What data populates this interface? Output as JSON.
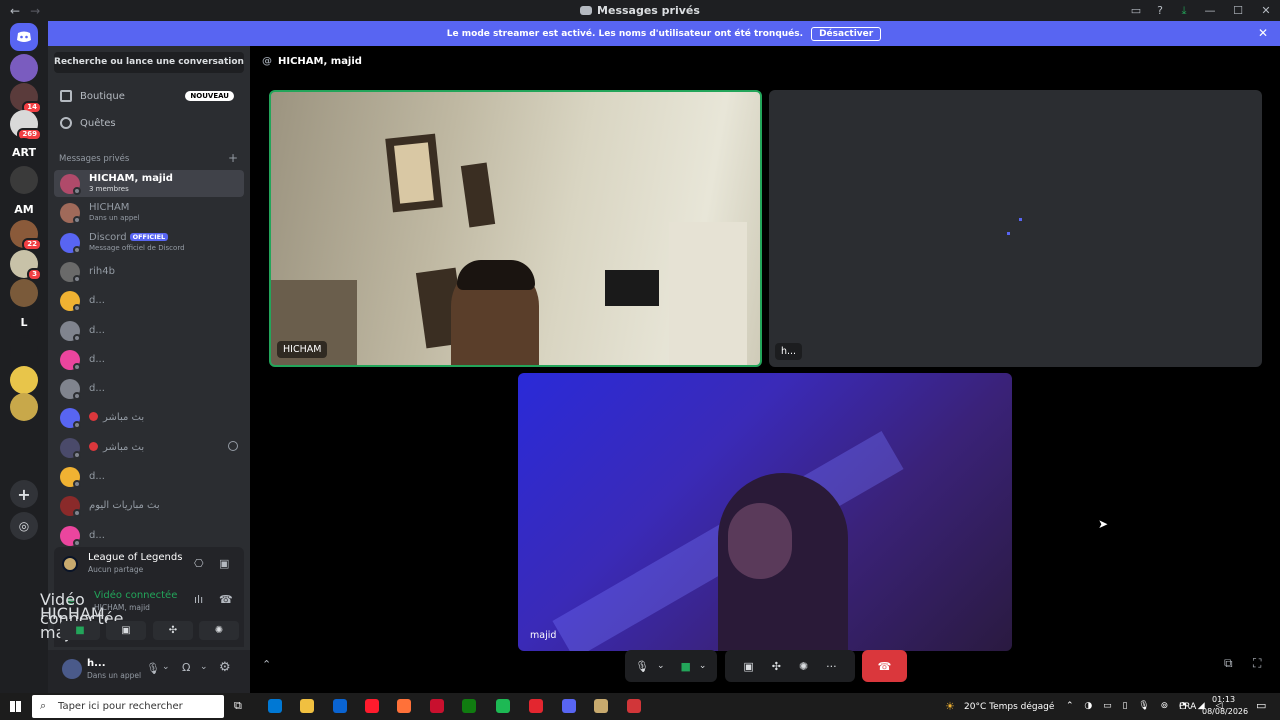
{
  "window": {
    "title": "Messages privés"
  },
  "guilds": [
    {
      "label": "",
      "badge": "",
      "color": "#5865f2"
    },
    {
      "label": "",
      "badge": "",
      "color": "#7a5cbf"
    },
    {
      "label": "",
      "badge": "14",
      "color": "#5a3b3b"
    },
    {
      "label": "",
      "badge": "269",
      "color": "#d9d9d9"
    },
    {
      "label": "ART",
      "badge": "",
      "color": "#1e1f22"
    },
    {
      "label": "",
      "badge": "",
      "color": "#3a3a3a"
    },
    {
      "label": "AM",
      "badge": "",
      "color": "#1e1f22"
    },
    {
      "label": "",
      "badge": "22",
      "color": "#8a5a3a"
    },
    {
      "label": "",
      "badge": "3",
      "color": "#c8c2a8"
    },
    {
      "label": "",
      "badge": "",
      "color": "#7a5a3a"
    },
    {
      "label": "L",
      "badge": "",
      "color": "#1e1f22"
    },
    {
      "label": "",
      "badge": "",
      "color": "#1e1f22"
    },
    {
      "label": "",
      "badge": "",
      "color": "#e8c54a"
    },
    {
      "label": "",
      "badge": "",
      "color": "#c8a84a"
    }
  ],
  "banner": {
    "text": "Le mode streamer est activé. Les noms d'utilisateur ont été tronqués.",
    "button": "Désactiver"
  },
  "sidebar": {
    "search_placeholder": "Recherche ou lance une conversation",
    "boutique": "Boutique",
    "nouveau": "NOUVEAU",
    "quetes": "Quêtes",
    "section_title": "Messages privés",
    "dms": [
      {
        "name": "HICHAM, majid",
        "sub": "3 membres",
        "color": "#b04a6a",
        "selected": true
      },
      {
        "name": "HICHAM",
        "sub": "Dans un appel",
        "color": "#a06a5a",
        "selected": false
      },
      {
        "name": "Discord",
        "sub": "Message officiel de Discord",
        "color": "#5865f2",
        "selected": false,
        "official": "OFFICIEL"
      },
      {
        "name": "rih4b",
        "sub": "",
        "color": "#6a6a6a",
        "selected": false
      },
      {
        "name": "d...",
        "sub": "",
        "color": "#f0b232",
        "selected": false
      },
      {
        "name": "d...",
        "sub": "",
        "color": "#80848e",
        "selected": false
      },
      {
        "name": "d...",
        "sub": "",
        "color": "#eb459e",
        "selected": false
      },
      {
        "name": "d...",
        "sub": "",
        "color": "#80848e",
        "selected": false
      },
      {
        "name": "بث مباشر",
        "sub": "",
        "color": "#5865f2",
        "selected": false,
        "live": true
      },
      {
        "name": "بث مباشر",
        "sub": "",
        "color": "#4a4a6a",
        "selected": false,
        "live": true,
        "closable": true
      },
      {
        "name": "d...",
        "sub": "",
        "color": "#f0b232",
        "selected": false
      },
      {
        "name": "بث مباريات اليوم",
        "sub": "",
        "color": "#8a2a2a",
        "selected": false
      },
      {
        "name": "d...",
        "sub": "",
        "color": "#eb459e",
        "selected": false
      }
    ]
  },
  "activity": {
    "game": "League of Legends",
    "status": "Aucun partage"
  },
  "voice": {
    "status": "Vidéo connectée",
    "channel": "HICHAM, majid"
  },
  "user": {
    "name": "h...",
    "status": "Dans un appel"
  },
  "main": {
    "header": "HICHAM, majid",
    "tiles": [
      {
        "label": "HICHAM"
      },
      {
        "label": "h..."
      },
      {
        "label": "majid"
      }
    ]
  },
  "taskbar": {
    "search_placeholder": "Taper ici pour rechercher",
    "weather": "20°C  Temps dégagé",
    "lang": "FRA",
    "time": "01:13",
    "date": "08/08/2026"
  },
  "colors": {
    "blurple": "#5865f2",
    "green": "#23a55a",
    "red": "#da373c",
    "sidebar": "#2b2d31"
  }
}
